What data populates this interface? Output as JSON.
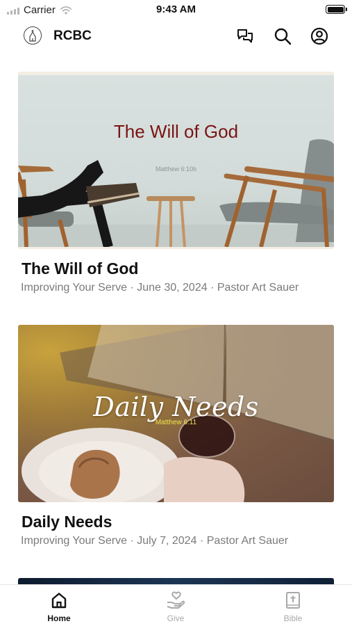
{
  "status_bar": {
    "carrier": "Carrier",
    "time": "9:43 AM"
  },
  "app_bar": {
    "title": "RCBC",
    "icons": [
      "church-logo-icon",
      "chat-icon",
      "search-icon",
      "account-icon"
    ]
  },
  "feed": {
    "items": [
      {
        "image_title": "The Will of God",
        "image_verse": "Matthew 6:10b",
        "title": "The Will of God",
        "meta": "Improving Your Serve · June 30, 2024 · Pastor Art Sauer"
      },
      {
        "image_title": "Daily Needs",
        "image_verse": "Matthew 6:11",
        "title": "Daily Needs",
        "meta": "Improving Your Serve · July 7, 2024 · Pastor Art Sauer"
      }
    ]
  },
  "tab_bar": {
    "tabs": [
      {
        "label": "Home",
        "icon": "home-icon",
        "active": true
      },
      {
        "label": "Give",
        "icon": "give-icon",
        "active": false
      },
      {
        "label": "Bible",
        "icon": "bible-icon",
        "active": false
      }
    ]
  },
  "colors": {
    "active_tab": "#111111",
    "inactive_tab": "#a8a8a8",
    "meta_text": "#7a7a7a",
    "will_of_god_title": "#7a1414",
    "daily_needs_verse": "#f1e34d"
  }
}
